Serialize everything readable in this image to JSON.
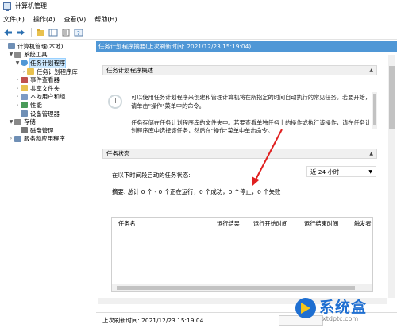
{
  "window": {
    "title": "计算机管理"
  },
  "menu": [
    "文件(F)",
    "操作(A)",
    "查看(V)",
    "帮助(H)"
  ],
  "toolbar": {
    "buttons": [
      "back-arrow",
      "forward-arrow",
      "folder-up",
      "console-tree",
      "properties",
      "help"
    ]
  },
  "tree": {
    "items": [
      {
        "label": "计算机管理(本地)",
        "level": 0,
        "arrow": "",
        "icon": "computer-icon"
      },
      {
        "label": "系统工具",
        "level": 1,
        "arrow": "▼",
        "icon": "tools-icon"
      },
      {
        "label": "任务计划程序",
        "level": 2,
        "arrow": "▼",
        "icon": "clock-icon",
        "selected": true
      },
      {
        "label": "任务计划程序库",
        "level": 3,
        "arrow": "›",
        "icon": "folder-icon"
      },
      {
        "label": "事件查看器",
        "level": 2,
        "arrow": "›",
        "icon": "event-viewer-icon"
      },
      {
        "label": "共享文件夹",
        "level": 2,
        "arrow": "›",
        "icon": "shared-folder-icon"
      },
      {
        "label": "本地用户和组",
        "level": 2,
        "arrow": "›",
        "icon": "users-icon"
      },
      {
        "label": "性能",
        "level": 2,
        "arrow": "›",
        "icon": "performance-icon"
      },
      {
        "label": "设备管理器",
        "level": 2,
        "arrow": "",
        "icon": "device-manager-icon"
      },
      {
        "label": "存储",
        "level": 1,
        "arrow": "▼",
        "icon": "storage-icon"
      },
      {
        "label": "磁盘管理",
        "level": 2,
        "arrow": "",
        "icon": "disk-icon"
      },
      {
        "label": "服务和应用程序",
        "level": 1,
        "arrow": "›",
        "icon": "services-icon"
      }
    ]
  },
  "right": {
    "header": "任务计划程序摘要(上次刷新时间: 2021/12/23 15:19:04)",
    "overview": {
      "title": "任务计划程序概述",
      "p1": "可以使用任务计划程序来创建和管理计算机将在所指定的时间自动执行的常见任务。若要开始，请单击\"操作\"菜单中的命令。",
      "p2": "任务存储在任务计划程序库的文件夹中。若要查看单独任务上的操作或执行该操作，请在任务计划程序库中选择该任务，然后在\"操作\"菜单中单击命令。"
    },
    "status": {
      "title": "任务状态",
      "label": "在以下时间段启动的任务状态:",
      "select_value": "近 24 小时",
      "summary": "摘要: 总计 0 个 - 0 个正在运行，0 个成功，0 个停止，0 个失败"
    },
    "table_headers": [
      "任务名",
      "运行结果",
      "运行开始时间",
      "运行结束时间",
      "触发者"
    ],
    "footer": "上次刷新时间: 2021/12/23 15:19:04"
  },
  "watermark": {
    "main": "系统盒",
    "sub": "xtdptc.com"
  },
  "colors": {
    "header_blue": "#4f97d6",
    "selection": "#cce8ff",
    "annotation_red": "#e02020",
    "watermark_blue": "#1f6fd1"
  }
}
